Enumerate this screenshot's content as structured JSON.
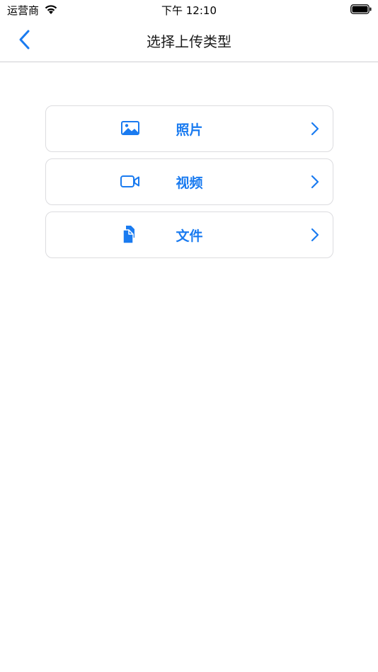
{
  "status_bar": {
    "carrier": "运营商",
    "time": "下午 12:10"
  },
  "nav": {
    "title": "选择上传类型",
    "back_icon": "chevron-left-icon"
  },
  "options": [
    {
      "label": "照片",
      "icon": "photo-icon"
    },
    {
      "label": "视频",
      "icon": "video-camera-icon"
    },
    {
      "label": "文件",
      "icon": "document-icon"
    }
  ],
  "colors": {
    "accent": "#1a7bf0",
    "border": "#dcdcdf",
    "divider": "#cfcfd2"
  }
}
